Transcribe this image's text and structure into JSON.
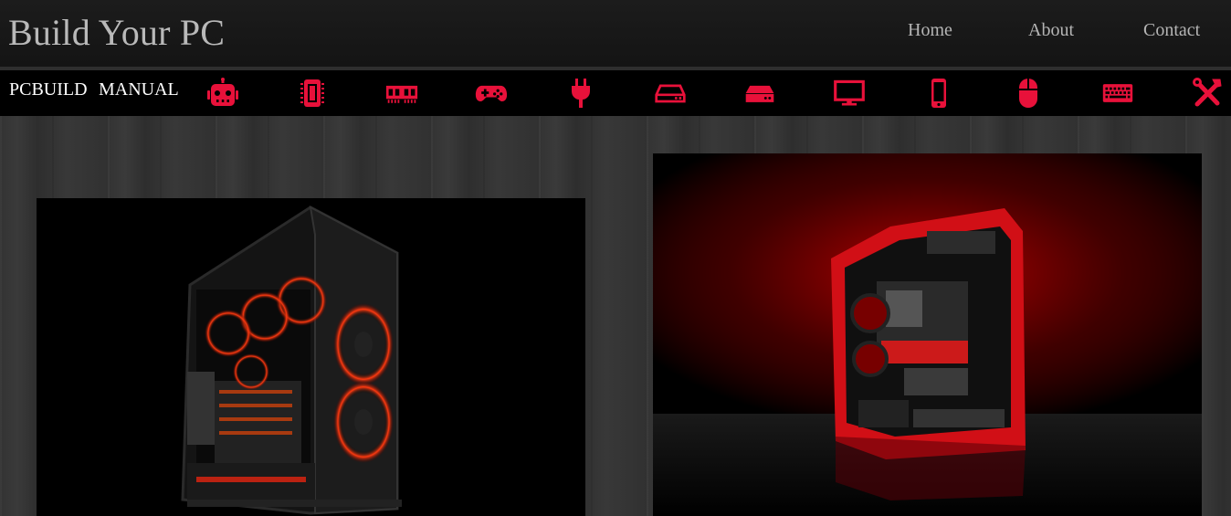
{
  "header": {
    "title": "Build Your PC",
    "nav": {
      "home": "Home",
      "about": "About",
      "contact": "Contact"
    }
  },
  "toolbar": {
    "pcbuild": "PCBUILD",
    "manual": "MANUAL",
    "accent": "#e8113a",
    "icons": [
      "robot-icon",
      "cpu-chip-icon",
      "ram-memory-icon",
      "gamepad-icon",
      "power-plug-icon",
      "hard-drive-icon",
      "ssd-drive-icon",
      "monitor-icon",
      "phone-icon",
      "mouse-icon",
      "keyboard-icon",
      "tools-icon"
    ]
  },
  "images": {
    "left": "black-pc-case-with-red-led-fans",
    "right": "red-pc-case-with-graphics-card"
  }
}
